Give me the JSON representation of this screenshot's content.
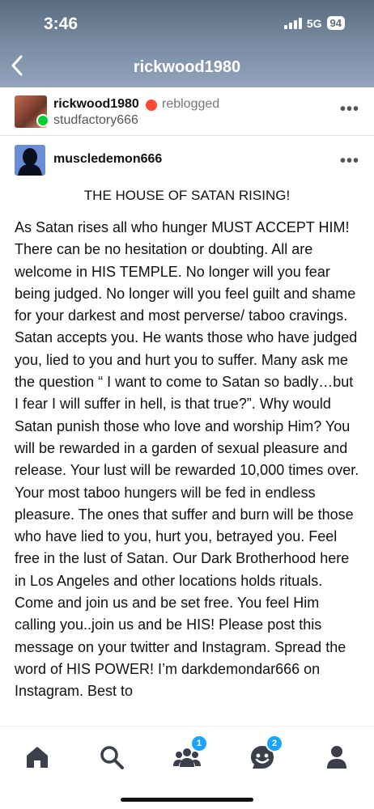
{
  "status_bar": {
    "time": "3:46",
    "network": "5G",
    "battery": "94"
  },
  "nav": {
    "title": "rickwood1980",
    "back_icon": "chevron-left-icon"
  },
  "reblog": {
    "user": "rickwood1980",
    "action": "reblogged",
    "from": "studfactory666",
    "more": "•••",
    "colors": {
      "reblog_badge": "#00cf35",
      "shield": "#ff4930"
    }
  },
  "post": {
    "author": "muscledemon666",
    "more": "•••",
    "headline": "THE HOUSE OF SATAN RISING!",
    "body": "As Satan rises all who hunger MUST ACCEPT HIM!  There can be no hesitation or doubting. All are welcome in HIS TEMPLE.  No longer will you fear being judged.  No longer will you feel guilt and shame for your darkest and most perverse/ taboo cravings.  Satan accepts you.  He wants those who have judged you, lied to you and hurt you to suffer.  Many ask me the question “ I want to come to Satan so badly…but I fear I will suffer in hell, is that true?”.  Why would Satan punish those who love and worship Him?  You will be rewarded in a garden of sexual pleasure and release.  Your lust will be rewarded 10,000 times over.  Your most taboo hungers will be fed in endless pleasure. The ones that suffer and burn will be those who have lied to you, hurt you, betrayed you. Feel free in the lust of Satan.  Our Dark Brotherhood here in Los Angeles and other locations holds rituals. Come and join us and be set free.  You feel Him calling you..join us and be HIS!  Please post this message on your twitter and Instagram. Spread the word of HIS POWER! I’m darkdemondar666 on Instagram. Best to"
  },
  "tabbar": {
    "items": [
      {
        "name": "home-icon"
      },
      {
        "name": "search-icon"
      },
      {
        "name": "community-icon",
        "badge": "1"
      },
      {
        "name": "activity-icon",
        "badge": "2"
      },
      {
        "name": "account-icon"
      }
    ],
    "badge_color": "#1aa3ff"
  }
}
